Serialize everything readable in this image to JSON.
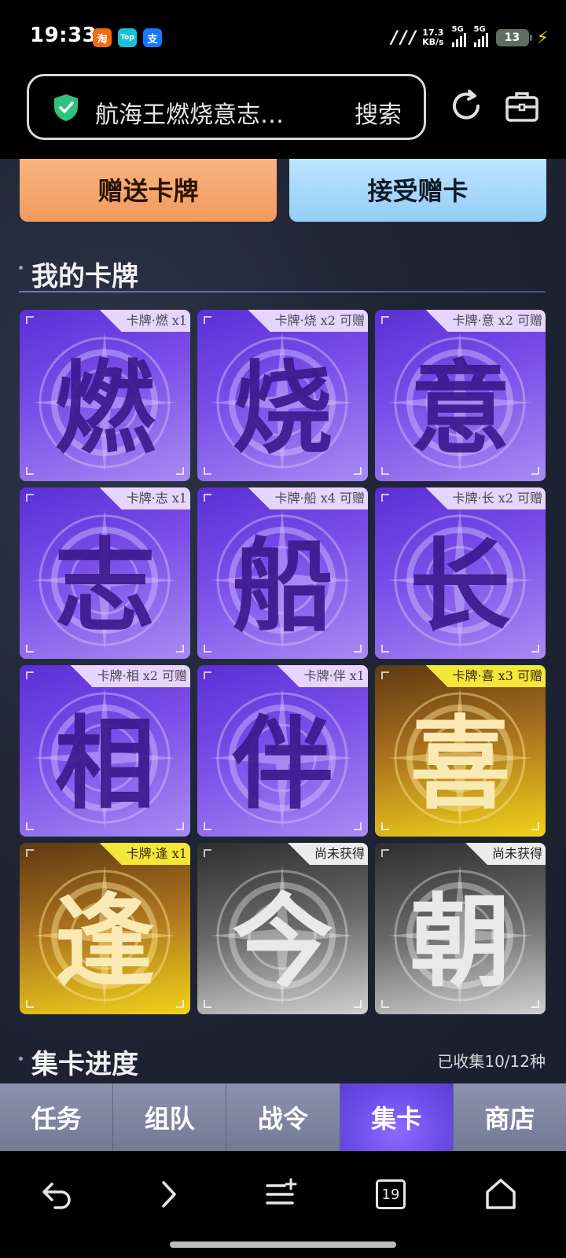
{
  "status_bar": {
    "time": "19:33",
    "app_icons": [
      {
        "name": "taobao-icon",
        "glyph": "淘",
        "color": "#f26b10"
      },
      {
        "name": "taopiaopiao-icon",
        "glyph": "Top",
        "color": "#19c0d6"
      },
      {
        "name": "alipay-icon",
        "glyph": "支",
        "color": "#1677ff"
      }
    ],
    "network_speed_value": "17.3",
    "network_speed_unit": "KB/s",
    "signal1_label": "5G",
    "signal2_label": "5G",
    "battery_level": "13"
  },
  "browser": {
    "url_text": "航海王燃烧意志…",
    "search_label": "搜索"
  },
  "actions": {
    "gift_label": "赠送卡牌",
    "accept_label": "接受赠卡"
  },
  "my_cards": {
    "title": "我的卡牌",
    "cards": [
      {
        "char": "燃",
        "tag": "卡牌·燃 x1",
        "style": "purple"
      },
      {
        "char": "烧",
        "tag": "卡牌·烧 x2 可赠",
        "style": "purple"
      },
      {
        "char": "意",
        "tag": "卡牌·意 x2 可赠",
        "style": "purple"
      },
      {
        "char": "志",
        "tag": "卡牌·志 x1",
        "style": "purple"
      },
      {
        "char": "船",
        "tag": "卡牌·船 x4 可赠",
        "style": "purple"
      },
      {
        "char": "长",
        "tag": "卡牌·长 x2 可赠",
        "style": "purple"
      },
      {
        "char": "相",
        "tag": "卡牌·相 x2 可赠",
        "style": "purple"
      },
      {
        "char": "伴",
        "tag": "卡牌·伴 x1",
        "style": "purple"
      },
      {
        "char": "喜",
        "tag": "卡牌·喜 x3 可赠",
        "style": "gold"
      },
      {
        "char": "逢",
        "tag": "卡牌·逢 x1",
        "style": "gold"
      },
      {
        "char": "今",
        "tag": "尚未获得",
        "style": "gray"
      },
      {
        "char": "朝",
        "tag": "尚未获得",
        "style": "gray"
      }
    ]
  },
  "progress": {
    "title": "集卡进度",
    "count_text": "已收集10/12种"
  },
  "bottom_nav": {
    "tabs": [
      {
        "label": "任务",
        "active": false
      },
      {
        "label": "组队",
        "active": false
      },
      {
        "label": "战令",
        "active": false
      },
      {
        "label": "集卡",
        "active": true
      },
      {
        "label": "商店",
        "active": false
      }
    ]
  },
  "system_nav": {
    "tabs_count": "19"
  }
}
